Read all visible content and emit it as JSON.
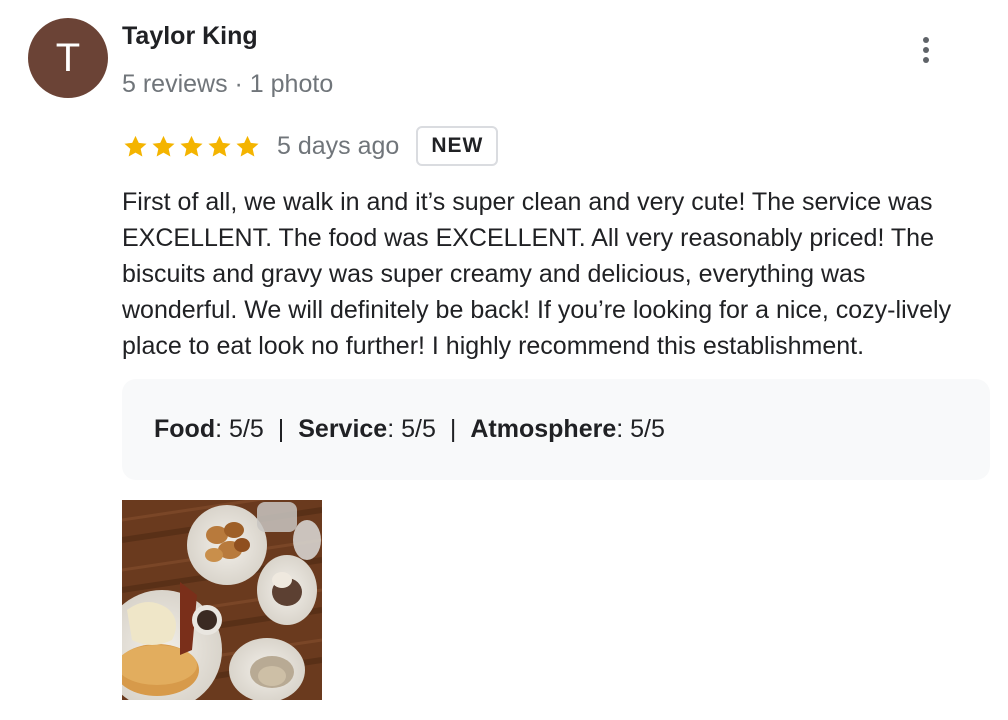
{
  "reviewer": {
    "avatar_initial": "T",
    "avatar_color": "#6b4336",
    "name": "Taylor King",
    "meta": "5 reviews · 1 photo"
  },
  "review": {
    "rating": 5,
    "max_rating": 5,
    "star_color": "#f4b400",
    "date": "5 days ago",
    "badge": "NEW",
    "text": "First of all, we walk in and it’s super clean and very cute! The service was EXCELLENT. The food was EXCELLENT. All very reasonably priced! The biscuits and gravy was super creamy and delicious, everything was wonderful. We will definitely be back! If you’re looking for a nice, cozy-lively place to eat look no further! I highly recommend this establishment."
  },
  "sub_ratings": {
    "food_label": "Food",
    "food_value": ": 5/5",
    "service_label": "Service",
    "service_value": ": 5/5",
    "atmosphere_label": "Atmosphere",
    "atmosphere_value": ": 5/5",
    "separator": "|"
  },
  "menu": {
    "icon": "more-vert-icon"
  },
  "photo": {
    "icon": "food-photo"
  }
}
